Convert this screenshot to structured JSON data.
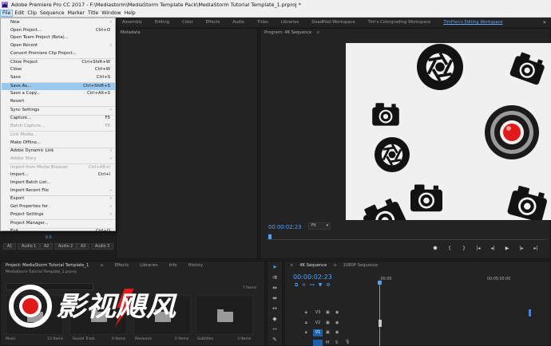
{
  "app": {
    "title": "Adobe Premiere Pro CC 2017 - F:\\Mediastorm\\MediaStorm Template Pack\\MediaStorm Tutorial Template_1.prproj *",
    "icon_label": "Pr"
  },
  "menubar": [
    "File",
    "Edit",
    "Clip",
    "Sequence",
    "Marker",
    "Title",
    "Window",
    "Help"
  ],
  "workspaces": {
    "tabs": [
      "Assembly",
      "Editing",
      "Color",
      "Effects",
      "Audio",
      "Titles",
      "Libraries",
      "DeadPool Workspace",
      "Tim's Colorgrading Workspace",
      "TimFlen's Editing Workspace"
    ],
    "active": "TimFlen's Editing Workspace",
    "more": "»"
  },
  "file_menu": [
    {
      "label": "New",
      "shortcut": "",
      "submenu": true,
      "disabled": false
    },
    {
      "label": "Open Project...",
      "shortcut": "Ctrl+O",
      "submenu": false,
      "disabled": false
    },
    {
      "label": "Open Team Project (Beta)...",
      "shortcut": "",
      "submenu": false,
      "disabled": false
    },
    {
      "label": "Open Recent",
      "shortcut": "",
      "submenu": true,
      "disabled": false
    },
    {
      "label": "Convert Premiere Clip Project...",
      "shortcut": "",
      "submenu": false,
      "disabled": false
    },
    {
      "label": "Close Project",
      "shortcut": "Ctrl+Shift+W",
      "submenu": false,
      "disabled": false
    },
    {
      "label": "Close",
      "shortcut": "Ctrl+W",
      "submenu": false,
      "disabled": false
    },
    {
      "label": "Save",
      "shortcut": "Ctrl+S",
      "submenu": false,
      "disabled": false
    },
    {
      "label": "Save As...",
      "shortcut": "Ctrl+Shift+S",
      "submenu": false,
      "disabled": false,
      "highlighted": true
    },
    {
      "label": "Save a Copy...",
      "shortcut": "Ctrl+Alt+S",
      "submenu": false,
      "disabled": false
    },
    {
      "label": "Revert",
      "shortcut": "",
      "submenu": false,
      "disabled": false
    },
    {
      "label": "Sync Settings",
      "shortcut": "",
      "submenu": true,
      "disabled": false
    },
    {
      "label": "Capture...",
      "shortcut": "F5",
      "submenu": false,
      "disabled": false
    },
    {
      "label": "Batch Capture...",
      "shortcut": "F6",
      "submenu": false,
      "disabled": true
    },
    {
      "label": "Link Media...",
      "shortcut": "",
      "submenu": false,
      "disabled": true
    },
    {
      "label": "Make Offline...",
      "shortcut": "",
      "submenu": false,
      "disabled": false
    },
    {
      "label": "Adobe Dynamic Link",
      "shortcut": "",
      "submenu": true,
      "disabled": false
    },
    {
      "label": "Adobe Story",
      "shortcut": "",
      "submenu": true,
      "disabled": true
    },
    {
      "label": "Import from Media Browser",
      "shortcut": "Ctrl+Alt+I",
      "submenu": false,
      "disabled": true
    },
    {
      "label": "Import...",
      "shortcut": "Ctrl+I",
      "submenu": false,
      "disabled": false
    },
    {
      "label": "Import Batch List...",
      "shortcut": "",
      "submenu": false,
      "disabled": false
    },
    {
      "label": "Import Recent File",
      "shortcut": "",
      "submenu": true,
      "disabled": false
    },
    {
      "label": "Export",
      "shortcut": "",
      "submenu": true,
      "disabled": false
    },
    {
      "label": "Get Properties for",
      "shortcut": "",
      "submenu": true,
      "disabled": false
    },
    {
      "label": "Project Settings",
      "shortcut": "",
      "submenu": true,
      "disabled": false
    },
    {
      "label": "Project Manager...",
      "shortcut": "",
      "submenu": false,
      "disabled": false
    },
    {
      "label": "Exit",
      "shortcut": "Ctrl+Q",
      "submenu": false,
      "disabled": false
    }
  ],
  "metadata_panel": {
    "title": "Metadata"
  },
  "program_monitor": {
    "title": "Program: 4K Sequence",
    "menu_icon": "≡",
    "timecode": "00:00:02:23",
    "fit": "Fit",
    "transport": [
      "marker-icon",
      "in-point-icon",
      "out-point-icon",
      "go-to-in-icon",
      "step-back-icon",
      "play-icon",
      "step-forward-icon",
      "go-to-out-icon"
    ]
  },
  "audio_strip": {
    "level": "0.0",
    "buttons": [
      "A1",
      "Audio 1",
      "A2",
      "Audio 2",
      "A3",
      "Audio 3"
    ]
  },
  "project_panel": {
    "tabs": [
      "Project: MediaStorm Tutorial Template_1",
      "Effects",
      "Libraries",
      "Info",
      "History"
    ],
    "active_tab": "Project: MediaStorm Tutorial Template_1",
    "menu_icon": "≡",
    "path": "MediaStorm Tutorial Template_1.prproj",
    "item_count": "7 Items",
    "bins": [
      {
        "name": "Music",
        "count": "13 Items"
      },
      {
        "name": "Sound Track",
        "count": "0 Items"
      },
      {
        "name": "Resource",
        "count": "0 Items"
      },
      {
        "name": "Subtitles",
        "count": "3 Items"
      }
    ]
  },
  "watermark": {
    "text": "影视飓风"
  },
  "timeline": {
    "tabs": [
      "4K Sequence",
      "1080P Sequence"
    ],
    "active_tab": "4K Sequence",
    "menu_icon": "≡",
    "close_icon": "×",
    "timecode": "00:00:02:23",
    "ruler": [
      ":00:00",
      "00:05:00:00"
    ],
    "tracks": [
      {
        "name": "V3",
        "selected": false
      },
      {
        "name": "V2",
        "selected": false
      },
      {
        "name": "V1",
        "selected": true
      },
      {
        "name": "",
        "selected": false
      }
    ],
    "audio_track_labels": [
      "M",
      "S"
    ]
  },
  "colors": {
    "accent": "#4aa3ff",
    "menu_highlight": "#99c9ef",
    "record_red": "#e21a1a"
  }
}
